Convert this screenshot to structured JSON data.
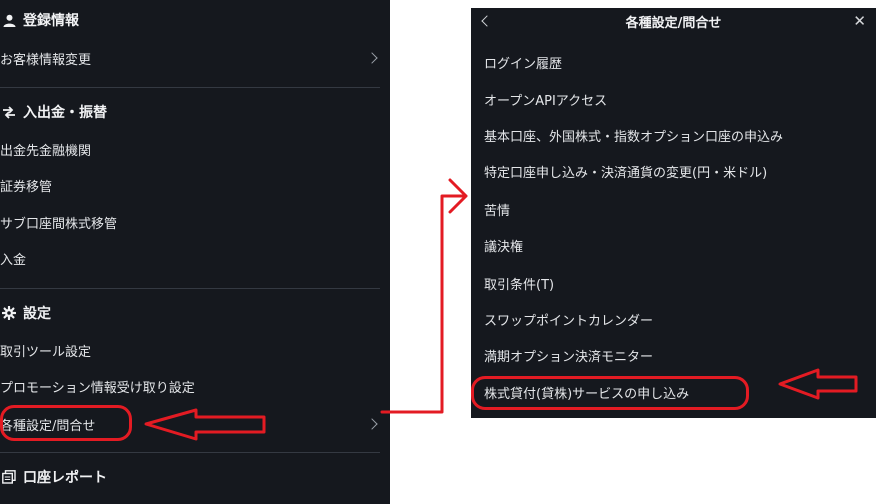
{
  "left_menu": {
    "sections": [
      {
        "title": "登録情報",
        "icon": "user-icon",
        "items": [
          {
            "label": "お客様情報変更",
            "chevron": true
          }
        ]
      },
      {
        "title": "入出金・振替",
        "icon": "transfer-arrows-icon",
        "items": [
          {
            "label": "出金先金融機関"
          },
          {
            "label": "証券移管"
          },
          {
            "label": "サブ口座間株式移管"
          },
          {
            "label": "入金"
          }
        ]
      },
      {
        "title": "設定",
        "icon": "gear-icon",
        "items": [
          {
            "label": "取引ツール設定"
          },
          {
            "label": "プロモーション情報受け取り設定"
          },
          {
            "label": "各種設定/問合せ",
            "chevron": true,
            "highlighted": true
          }
        ]
      },
      {
        "title": "口座レポート",
        "icon": "report-icon",
        "items": []
      }
    ]
  },
  "dialog": {
    "title": "各種設定/問合せ",
    "back_icon": "chevron-left-icon",
    "close_icon": "close-icon",
    "close_glyph": "✕",
    "items": [
      {
        "label": "ログイン履歴"
      },
      {
        "label": "オープンAPIアクセス"
      },
      {
        "label": "基本口座、外国株式・指数オプション口座の申込み"
      },
      {
        "label": "特定口座申し込み・決済通貨の変更(円・米ドル)"
      },
      {
        "label": "苦情"
      },
      {
        "label": "議決権"
      },
      {
        "label": "取引条件(T)"
      },
      {
        "label": "スワップポイントカレンダー"
      },
      {
        "label": "満期オプション決済モニター"
      },
      {
        "label": "株式貸付(貸株)サービスの申し込み",
        "highlighted": true
      }
    ]
  },
  "annotation_color": "#e31b23",
  "panel_background": "#15181e"
}
